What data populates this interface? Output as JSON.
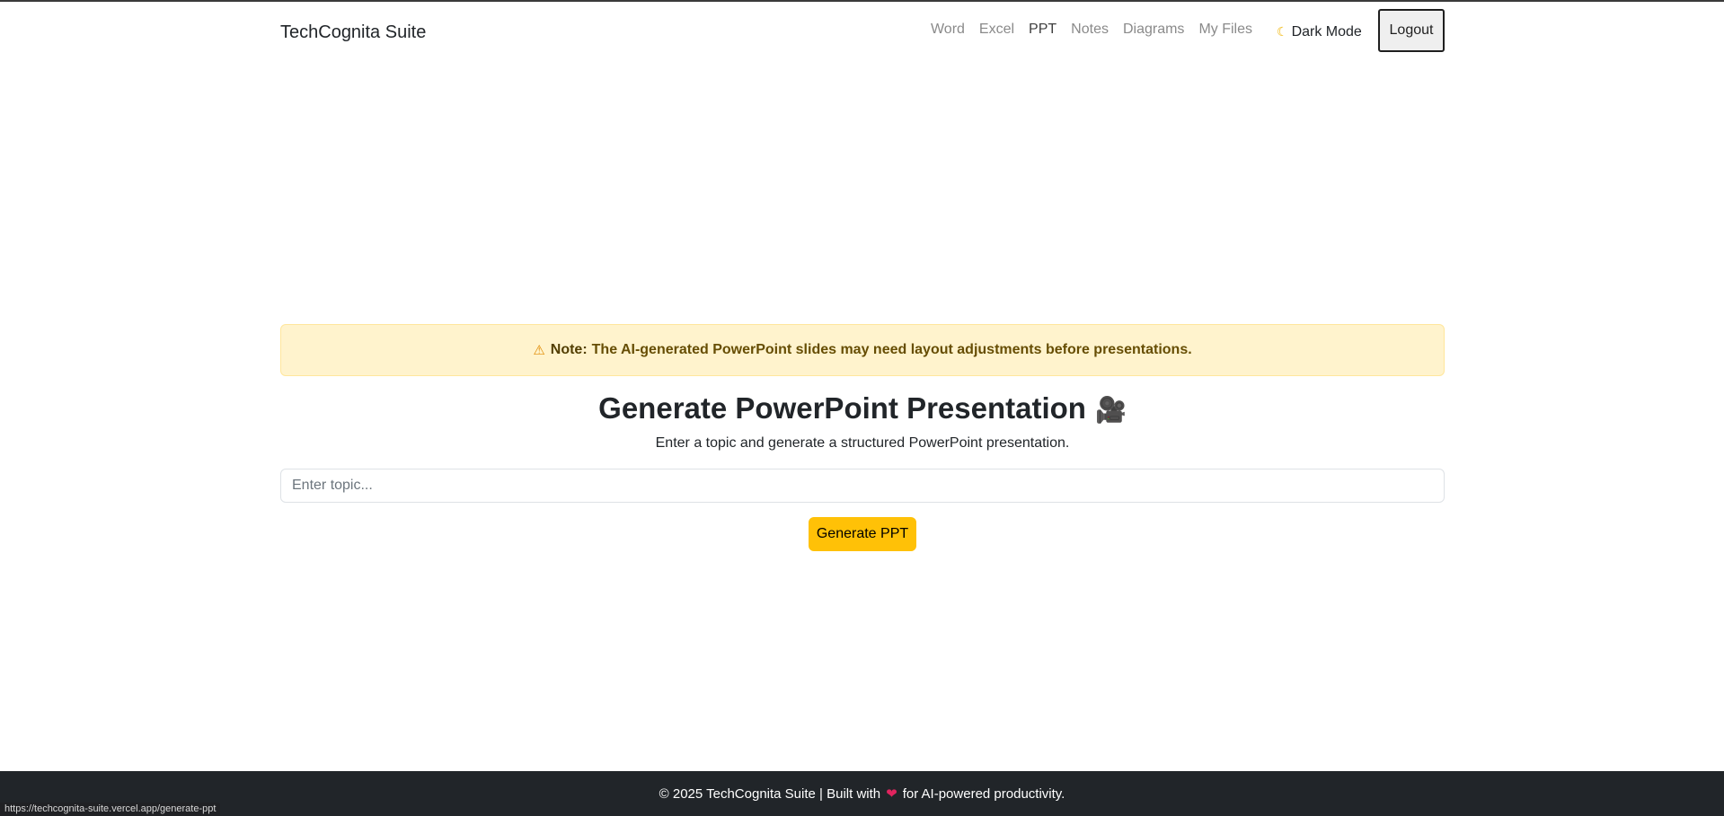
{
  "navbar": {
    "brand": "TechCognita Suite",
    "links": [
      {
        "label": "Word",
        "active": false
      },
      {
        "label": "Excel",
        "active": false
      },
      {
        "label": "PPT",
        "active": true
      },
      {
        "label": "Notes",
        "active": false
      },
      {
        "label": "Diagrams",
        "active": false
      },
      {
        "label": "My Files",
        "active": false
      }
    ],
    "dark_mode_icon": "moon-icon",
    "dark_mode_label": "Dark Mode",
    "logout_label": "Logout"
  },
  "alert": {
    "icon": "warning-icon",
    "note_label": "Note:",
    "message": "The AI-generated PowerPoint slides may need layout adjustments before presentations."
  },
  "main": {
    "title": "Generate PowerPoint Presentation",
    "title_icon": "movie-camera-icon",
    "subtitle": "Enter a topic and generate a structured PowerPoint presentation.",
    "topic_input": {
      "value": "",
      "placeholder": "Enter topic..."
    },
    "generate_button": "Generate PPT"
  },
  "footer": {
    "text_before": "© 2025 TechCognita Suite | Built with",
    "heart_icon": "heart-icon",
    "text_after": "for AI-powered productivity."
  },
  "status_bar": {
    "url": "https://techcognita-suite.vercel.app/generate-ppt"
  },
  "colors": {
    "alert_background": "#fff3cd",
    "alert_text": "#664d03",
    "button_accent": "#ffc107",
    "footer_background": "#212529"
  }
}
